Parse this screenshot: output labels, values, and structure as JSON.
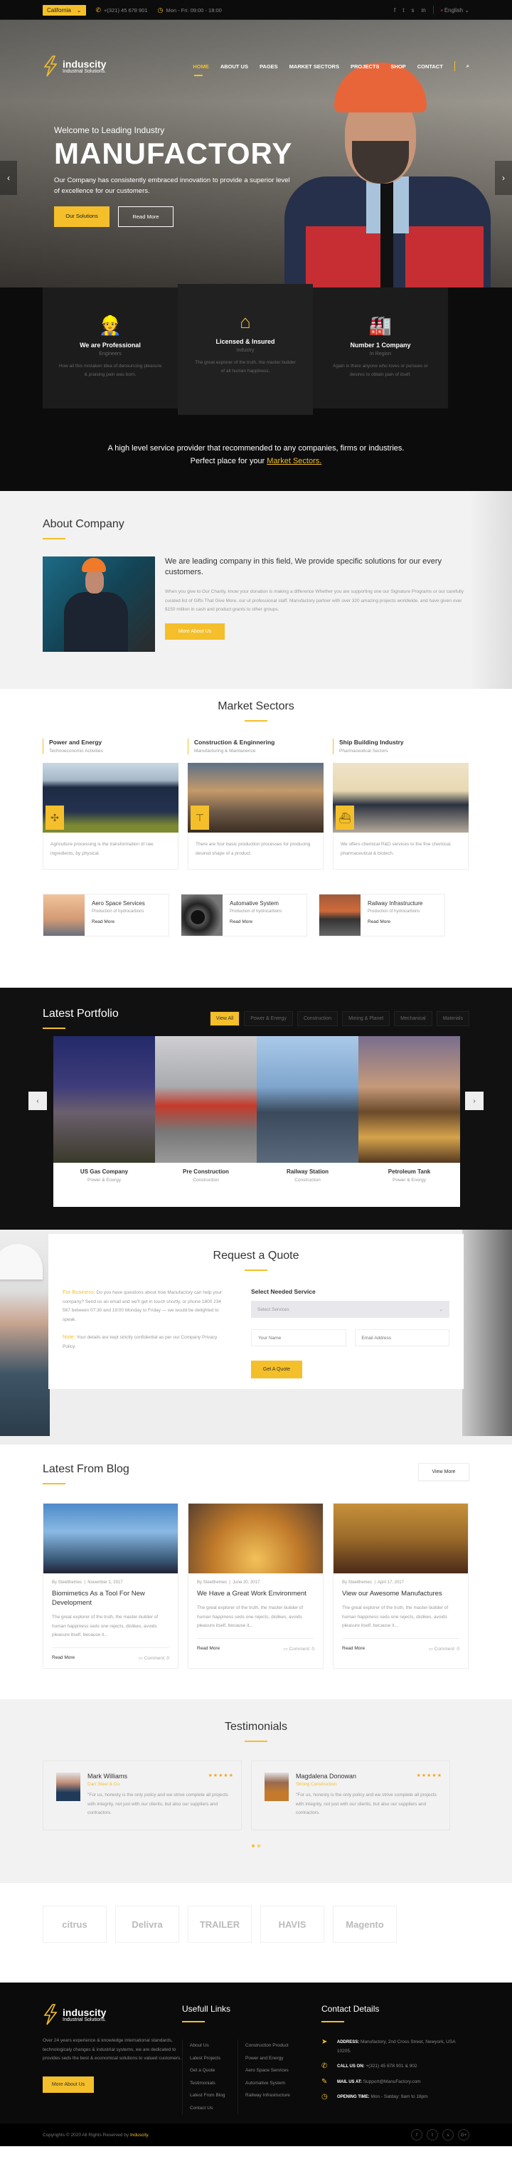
{
  "topbar": {
    "location": "California",
    "phone": "+(321) 45 678 901",
    "hours": "Mon - Fri: 09:00 - 18:00",
    "language": "English",
    "social_icons": [
      "facebook-icon",
      "twitter-icon",
      "skype-icon",
      "linkedin-icon"
    ]
  },
  "brand": {
    "name": "induscity",
    "tagline": "Industrial Solutions."
  },
  "nav": {
    "items": [
      "HOME",
      "ABOUT US",
      "PAGES",
      "MARKET SECTORS",
      "PROJECTS",
      "SHOP",
      "CONTACT"
    ],
    "active": "HOME"
  },
  "hero": {
    "subtitle": "Welcome to Leading Industry",
    "title": "MANUFACTORY",
    "text": "Our Company has consistently embraced innovation to provide a superior level of excellence for our customers.",
    "primary_button": "Our Solutions",
    "secondary_button": "Read More"
  },
  "features": {
    "items": [
      {
        "title": "We are Professional",
        "sub": "Engineers",
        "text": "How all this mistaken idea of denouncing pleasure & praising pain was born."
      },
      {
        "title": "Licensed & Insured",
        "sub": "Industry",
        "text": "The great explorer of the truth, the master builder of all human happiness."
      },
      {
        "title": "Number 1 Company",
        "sub": "In Region",
        "text": "Again is there anyone who loves or pursues or desires to obtain pain of itself."
      }
    ],
    "note_line1": "A high level service provider that recommended to any companies, firms or industries.",
    "note_line2": "Perfect place for your ",
    "note_link": "Market Sectors."
  },
  "about": {
    "heading": "About Company",
    "lead": "We are leading company in this field, We provide specific solutions for our every customers.",
    "body": "When you give to Our Charity, know your donation is making a difference Whether you are supporting one our Signature Programs or our carefully curated list of Gifts That Give More, our ut professional staff. Manufactory partner with over 320 amazing projects worldwide, and have given over $150 million in cash and product grants to other groups.",
    "button": "More About Us"
  },
  "sectors": {
    "heading": "Market Sectors",
    "items": [
      {
        "title": "Power and Energy",
        "sub": "Technoeconomic Activities",
        "text": "Agriculture processing is the transformation of raw ingredients, by physical."
      },
      {
        "title": "Construction & Enginnering",
        "sub": "Manufacturing & Maintanence",
        "text": "There are four basic production processes for producing desired shape of a product."
      },
      {
        "title": "Ship Building Industry",
        "sub": "Pharmaceutical Sectors",
        "text": "We offers chemical R&D services to the fine chemical, pharmaceutical & biotech."
      }
    ],
    "mini": [
      {
        "title": "Aero Space Services",
        "sub": "Production of hydrocarbons",
        "link": "Read More"
      },
      {
        "title": "Automative System",
        "sub": "Production of hydrocarbons",
        "link": "Read More"
      },
      {
        "title": "Railway Infrastructure",
        "sub": "Production of hydrocarbons",
        "link": "Read More"
      }
    ]
  },
  "portfolio": {
    "heading": "Latest Portfolio",
    "tabs": [
      "View All",
      "Power & Energy",
      "Construction",
      "Mining & Planet",
      "Mechanical",
      "Materials"
    ],
    "active_tab": "View All",
    "items": [
      {
        "title": "US Gas Company",
        "category": "Power & Energy"
      },
      {
        "title": "Pre Construction",
        "category": "Construction"
      },
      {
        "title": "Railway Station",
        "category": "Construction"
      },
      {
        "title": "Petroleum Tank",
        "category": "Power & Energy"
      }
    ]
  },
  "quote": {
    "heading": "Request a Quote",
    "business_label": "For Business:",
    "business_text": " Do you have questions about how Manufactory can help your company? Send us an email and we'll get in touch shortly, or phone 1800 234 567 between 07:30 and 19:00 Monday to Friday — we would be delighted to speak.",
    "note_label": "Note:",
    "note_text": " Your details are kept strictly confidential as per our Company Privacy Policy.",
    "form_title": "Select Needed Service",
    "select_value": "Select Services",
    "name_placeholder": "Your Name",
    "email_placeholder": "Email Address",
    "button": "Get A Quote"
  },
  "blog": {
    "heading": "Latest From Blog",
    "view_more": "View More",
    "posts": [
      {
        "author": "By Steelthemes",
        "date": "November 1, 2017",
        "title": "Biomimetics As a Tool For New Development",
        "excerpt": "The great explorer of the truth, the master-builder of human happiness seds one rejects, dislikes, avoids pleasure itself, because it...",
        "link": "Read More",
        "comments": "Comment: 0"
      },
      {
        "author": "By Steelthemes",
        "date": "June 20, 2017",
        "title": "We Have a Great Work Environment",
        "excerpt": "The great explorer of the truth, the master-builder of human happiness seds one rejects, dislikes, avoids pleasure itself, because it...",
        "link": "Read More",
        "comments": "Comment: 0"
      },
      {
        "author": "By Steelthemes",
        "date": "April 17, 2017",
        "title": "View our Awesome Manufactures",
        "excerpt": "The great explorer of the truth, the master-builder of human happiness seds one rejects, dislikes, avoids pleasure itself, because it...",
        "link": "Read More",
        "comments": "Comment: 0"
      }
    ]
  },
  "testimonials": {
    "heading": "Testimonials",
    "items": [
      {
        "name": "Mark Williams",
        "company": "Dart Steel & Co",
        "rating": 5,
        "text": "\"For us, honesty is the only policy and we strive complete all projects with integrity, not just with our clients, but also our suppliers and contractors."
      },
      {
        "name": "Magdalena Donowan",
        "company": "Strong Construction",
        "rating": 5,
        "text": "\"For us, honesty is the only policy and we strive complete all projects with integrity, not just with our clients, but also our suppliers and contractors."
      }
    ],
    "stars": "★★★★★",
    "pages": 2,
    "current_page": 1
  },
  "clients": [
    "citrus",
    "Delivra",
    "TRAILER",
    "HAVIS",
    "Magento"
  ],
  "footer": {
    "about": "Over 24 years experience & knowledge international standards, technologicaly changes & industrial systems, we are dedicated to provides seds the best & economical solutions to valued customers.",
    "button": "More About Us",
    "links_heading": "Usefull Links",
    "links_col1": [
      "About Us",
      "Latest Projects",
      "Get a Quote",
      "Testimonials",
      "Latest From Blog",
      "Contact Us"
    ],
    "links_col2": [
      "Construction Product",
      "Power and Energy",
      "Aero Space Services",
      "Automative System",
      "Railway Infrastructure"
    ],
    "contact_heading": "Contact Details",
    "contact": [
      {
        "label": "ADDRESS:",
        "value": " Manufactory, 2nd Cross Street, Newyork, USA 10205."
      },
      {
        "label": "CALL US ON:",
        "value": " +(321) 45 678 901 & 902"
      },
      {
        "label": "MAIL US AT:",
        "value": " Support@ManuFactory.com"
      },
      {
        "label": "OPENING TIME:",
        "value": " Mon - Satday: 9am to 18pm"
      }
    ],
    "copyright": "Copyrights © 2020 All Rights Reserved by ",
    "copyright_brand": "Induscity."
  },
  "colors": {
    "accent": "#f4bf2a",
    "dark": "#0c0c0c"
  }
}
